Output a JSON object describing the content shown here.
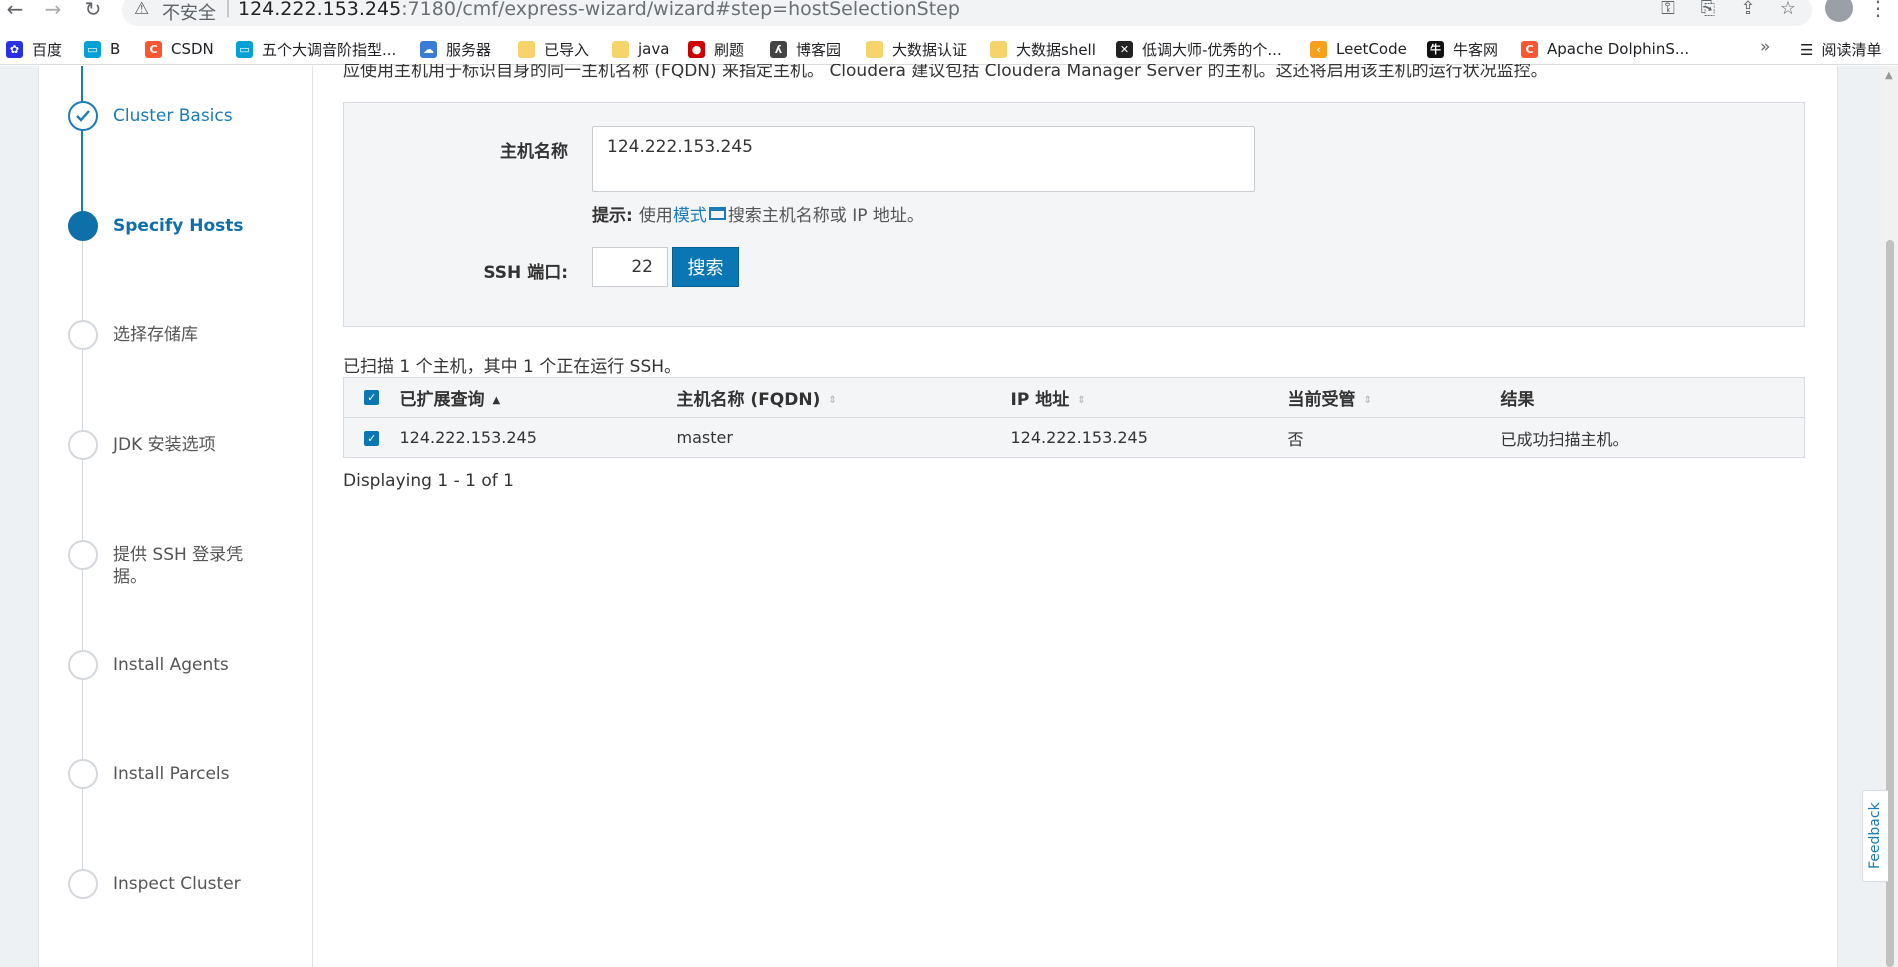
{
  "browser": {
    "insecure_label": "不安全",
    "url_host": "124.222.153.245",
    "url_path": ":7180/cmf/express-wizard/wizard#step=hostSelectionStep",
    "bookmarks": [
      {
        "label": "百度",
        "icon": "paw-icon",
        "color": "#2932e1"
      },
      {
        "label": "B",
        "icon": "bilibili-icon",
        "color": "#00a1d6"
      },
      {
        "label": "CSDN",
        "icon": "csdn-icon",
        "color": "#fc5531"
      },
      {
        "label": "五个大调音阶指型...",
        "icon": "bilibili-icon",
        "color": "#00a1d6"
      },
      {
        "label": "服务器",
        "icon": "cloud-icon",
        "color": "#3a7bd5"
      },
      {
        "label": "已导入",
        "icon": "folder-icon",
        "color": "#f6d36b"
      },
      {
        "label": "java",
        "icon": "folder-icon",
        "color": "#f6d36b"
      },
      {
        "label": "刷题",
        "icon": "redhat-icon",
        "color": "#cc0000"
      },
      {
        "label": "博客园",
        "icon": "cnblogs-icon",
        "color": "#444444"
      },
      {
        "label": "大数据认证",
        "icon": "folder-icon",
        "color": "#f6d36b"
      },
      {
        "label": "大数据shell",
        "icon": "folder-icon",
        "color": "#f6d36b"
      },
      {
        "label": "低调大师-优秀的个...",
        "icon": "dna-icon",
        "color": "#222222"
      },
      {
        "label": "LeetCode",
        "icon": "leetcode-icon",
        "color": "#f89f1b"
      },
      {
        "label": "牛客网",
        "icon": "nowcoder-icon",
        "color": "#111111"
      },
      {
        "label": "Apache DolphinS...",
        "icon": "csdn-icon",
        "color": "#fc5531"
      }
    ],
    "bookmarks_more": "»",
    "reading_list": "阅读清单"
  },
  "wizard": {
    "steps": [
      {
        "label": "Cluster Basics",
        "state": "done"
      },
      {
        "label": "Specify Hosts",
        "state": "current"
      },
      {
        "label": "选择存储库",
        "state": "todo"
      },
      {
        "label": "JDK 安装选项",
        "state": "todo"
      },
      {
        "label": "提供 SSH 登录凭据。",
        "state": "todo"
      },
      {
        "label": "Install Agents",
        "state": "todo"
      },
      {
        "label": "Install Parcels",
        "state": "todo"
      },
      {
        "label": "Inspect Cluster",
        "state": "todo"
      }
    ]
  },
  "main": {
    "intro_text": "应使用主机用于标识自身的同一主机名称 (FQDN) 来指定主机。 Cloudera 建议包括 Cloudera Manager Server 的主机。这还将启用该主机的运行状况监控。",
    "hostname_label": "主机名称",
    "hostname_value": "124.222.153.245",
    "hint_prefix": "提示:",
    "hint_use": "使用",
    "hint_link": "模式",
    "hint_rest": "搜索主机名称或 IP 地址。",
    "ssh_port_label": "SSH 端口:",
    "ssh_port_value": "22",
    "search_button": "搜索",
    "scan_summary": "已扫描 1 个主机，其中 1 个正在运行 SSH。",
    "table": {
      "columns": [
        "已扩展查询",
        "主机名称 (FQDN)",
        "IP 地址",
        "当前受管",
        "结果"
      ],
      "rows": [
        {
          "query": "124.222.153.245",
          "fqdn": "master",
          "ip": "124.222.153.245",
          "managed": "否",
          "result": "已成功扫描主机。"
        }
      ]
    },
    "displaying": "Displaying 1 - 1 of 1"
  },
  "feedback_label": "Feedback"
}
